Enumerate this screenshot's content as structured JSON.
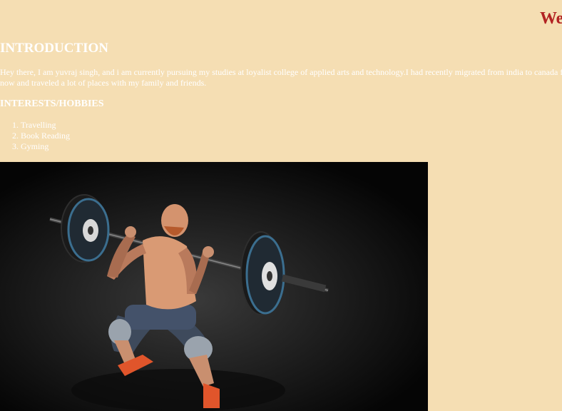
{
  "header": {
    "welcome_text": "We"
  },
  "introduction": {
    "heading": "INTRODUCTION",
    "text": "Hey there, I am yuvraj singh, and i am currently pursuing my studies at loyalist college of applied arts and technology.I had recently migrated from india to canada f books till now and traveled a lot of places with my family and friends."
  },
  "interests": {
    "heading": "INTERESTS/HOBBIES",
    "items": [
      "Travelling",
      "Book Reading",
      "Gyming"
    ]
  },
  "colors": {
    "background": "#f5deb3",
    "text": "#ffffff",
    "welcome": "#b22222"
  },
  "photo": {
    "subject": "weightlifter-photo"
  }
}
